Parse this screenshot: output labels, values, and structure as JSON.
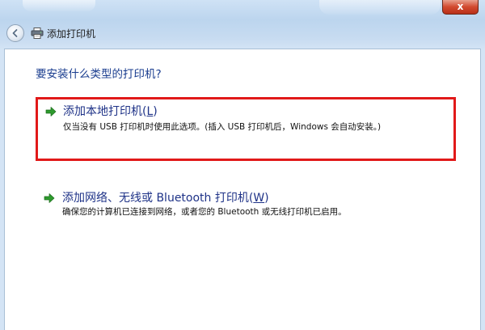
{
  "window": {
    "title": "添加打印机",
    "close_label": "x"
  },
  "main": {
    "question": "要安装什么类型的打印机?",
    "options": [
      {
        "title": "添加本地打印机(",
        "accelerator": "L",
        "title_end": ")",
        "description": "仅当没有 USB 打印机时使用此选项。(插入 USB 打印机后，Windows 会自动安装。)",
        "highlighted": true,
        "highlight_color": "#e11919"
      },
      {
        "title": "添加网络、无线或 Bluetooth 打印机(",
        "accelerator": "W",
        "title_end": ")",
        "description": "确保您的计算机已连接到网络，或者您的 Bluetooth 或无线打印机已启用。",
        "highlighted": false
      }
    ]
  },
  "icons": {
    "back": "back-arrow-icon",
    "printer": "printer-icon",
    "option_arrow": "green-arrow-icon"
  },
  "colors": {
    "accent_text": "#1e3287",
    "arrow_green": "#2e9b2e",
    "close_red": "#d24a2f"
  }
}
